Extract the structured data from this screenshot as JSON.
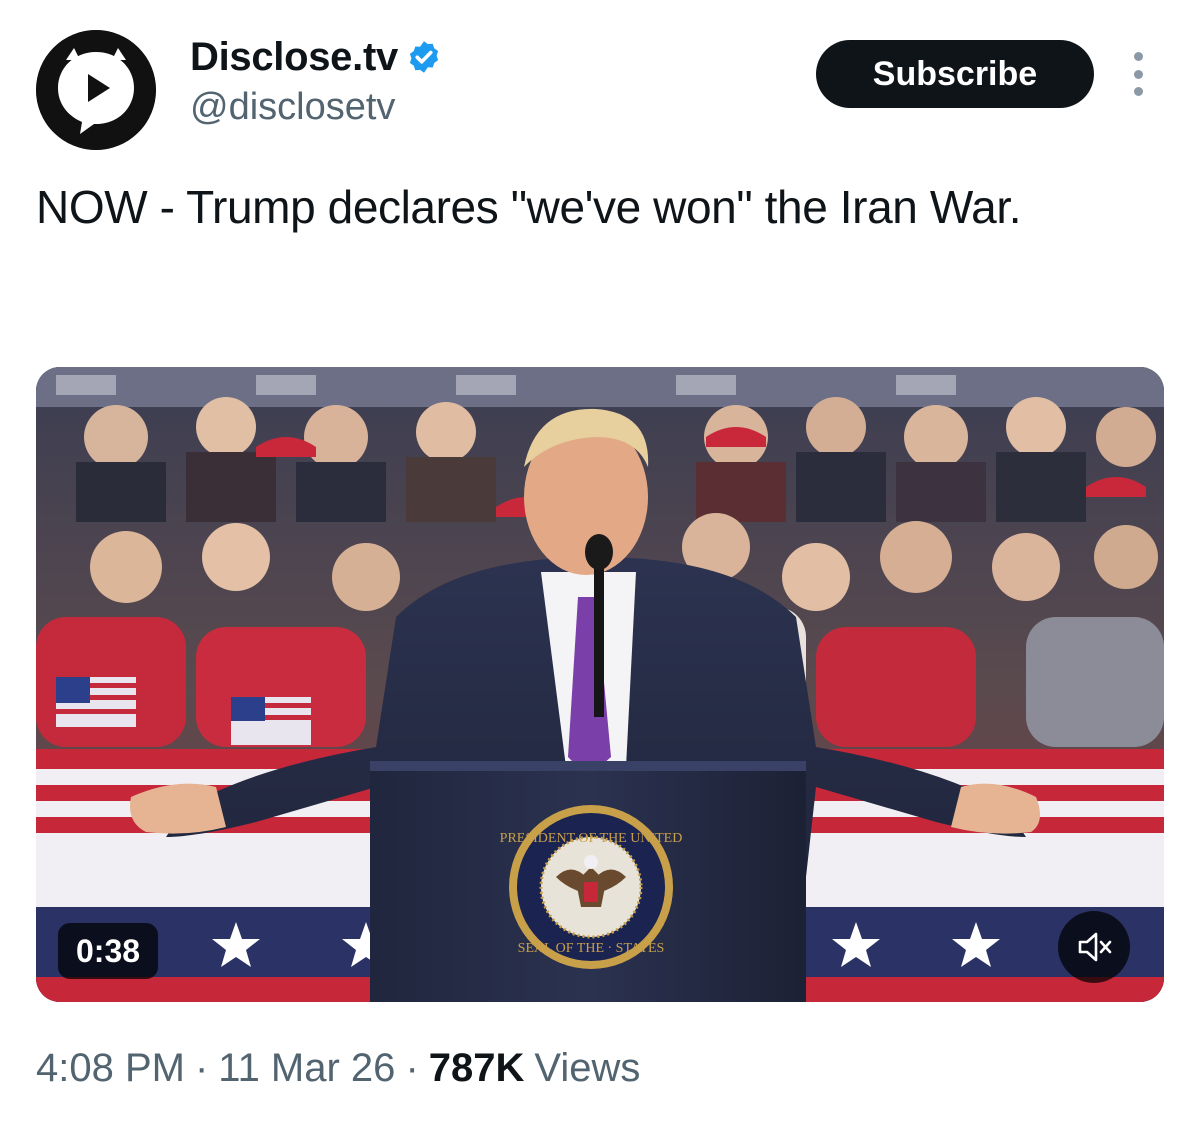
{
  "account": {
    "display_name": "Disclose.tv",
    "handle": "@disclosetv",
    "verified": true,
    "verified_color": "#1d9bf0",
    "avatar_icon": "play-speech-bubble-icon"
  },
  "actions": {
    "subscribe_label": "Subscribe",
    "more_icon": "vertical-ellipsis-icon"
  },
  "tweet": {
    "text": "NOW - Trump declares \"we've won\" the Iran War."
  },
  "video": {
    "duration": "0:38",
    "mute_icon": "speaker-muted-icon",
    "seal_text_top": "PRESIDENT OF THE UNITED",
    "seal_text_bottom": "SEAL OF THE · STATES"
  },
  "meta": {
    "time": "4:08 PM",
    "date": "11 Mar 26",
    "separator": "·",
    "views_count": "787K",
    "views_label": "Views"
  },
  "colors": {
    "text_primary": "#0f1419",
    "text_secondary": "#536471",
    "button_bg": "#0f1419"
  }
}
